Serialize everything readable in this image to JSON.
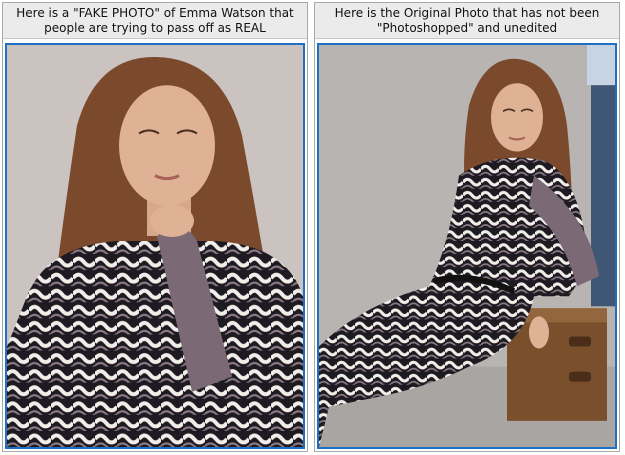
{
  "panels": [
    {
      "caption": "Here is a \"FAKE PHOTO\" of Emma Watson that people are trying to pass off as REAL"
    },
    {
      "caption": "Here is the Original Photo that has not been \"Photoshopped\" and unedited"
    }
  ],
  "colors": {
    "frame_border": "#1f6fc5",
    "caption_bg": "#ebebeb"
  }
}
